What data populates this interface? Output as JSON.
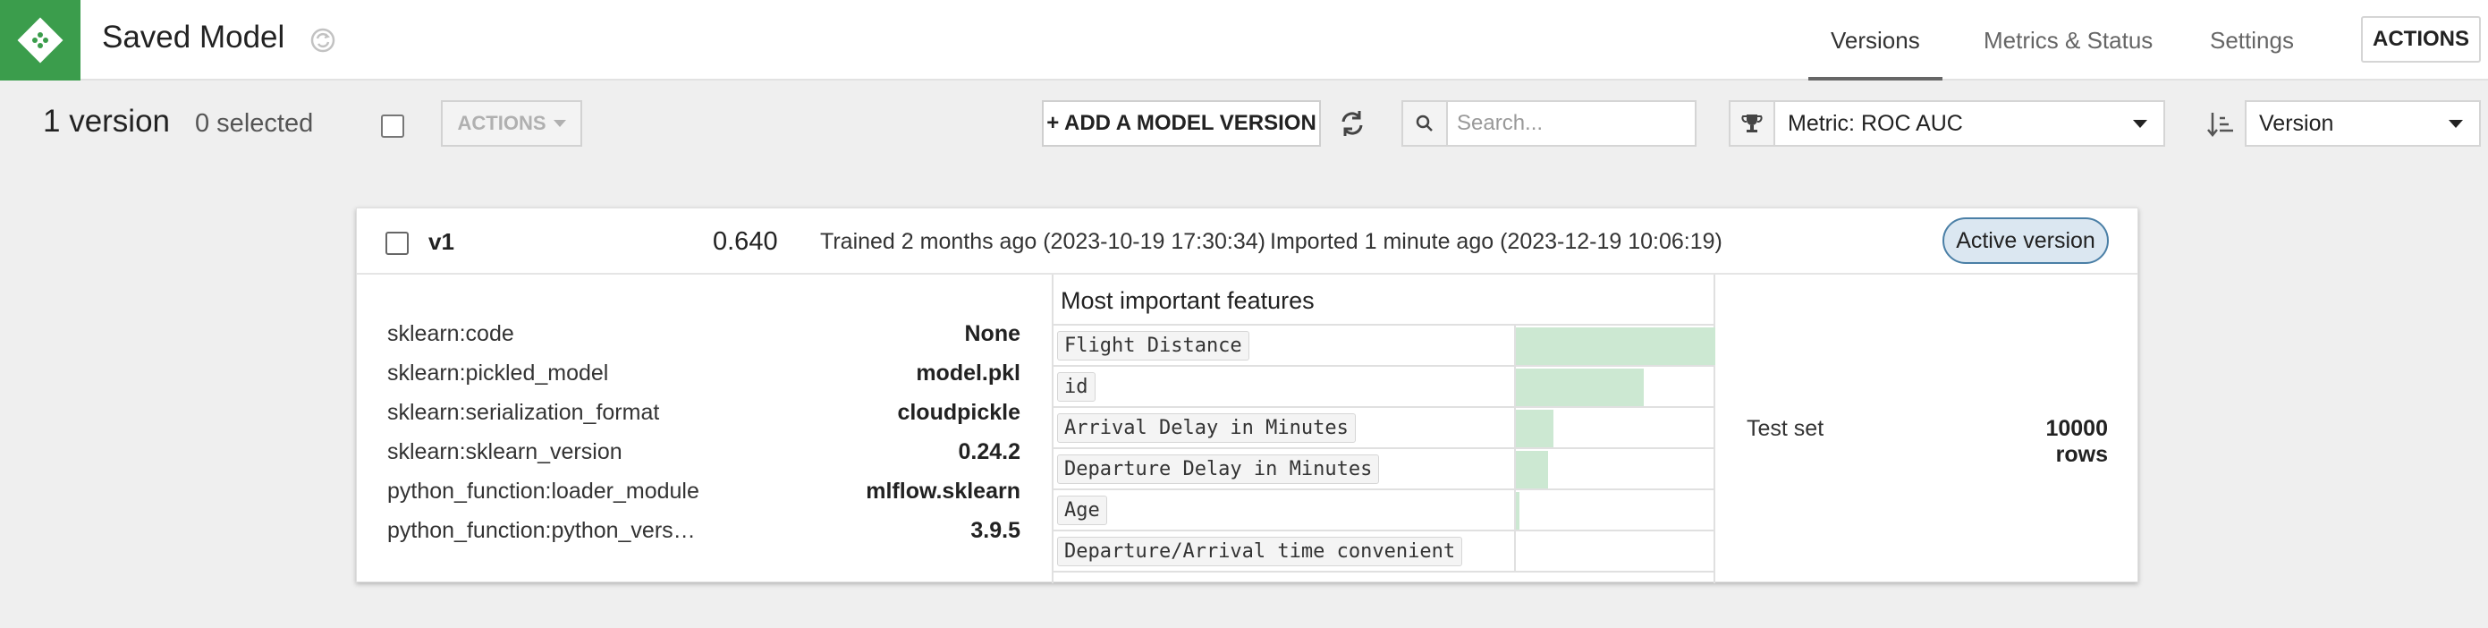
{
  "header": {
    "title": "Saved Model",
    "tabs": [
      {
        "label": "Versions",
        "active": true
      },
      {
        "label": "Metrics & Status",
        "active": false
      },
      {
        "label": "Settings",
        "active": false
      }
    ],
    "actions_label": "ACTIONS"
  },
  "toolbar": {
    "version_count": "1 version",
    "selected_count": "0 selected",
    "actions_label": "ACTIONS",
    "add_version_label": "+ ADD A MODEL VERSION",
    "search_placeholder": "Search...",
    "metric_label": "Metric: ROC AUC",
    "sort_label": "Version"
  },
  "version_card": {
    "name": "v1",
    "metric_value": "0.640",
    "trained": "Trained 2 months ago (2023-10-19 17:30:34)",
    "imported": "Imported 1 minute ago (2023-12-19 10:06:19)",
    "status": "Active version",
    "params": [
      {
        "key": "sklearn:code",
        "value": "None"
      },
      {
        "key": "sklearn:pickled_model",
        "value": "model.pkl"
      },
      {
        "key": "sklearn:serialization_format",
        "value": "cloudpickle"
      },
      {
        "key": "sklearn:sklearn_version",
        "value": "0.24.2"
      },
      {
        "key": "python_function:loader_module",
        "value": "mlflow.sklearn"
      },
      {
        "key": "python_function:python_vers…",
        "value": "3.9.5"
      }
    ],
    "features_title": "Most important features",
    "features": [
      {
        "name": "Flight Distance",
        "importance": 1.0
      },
      {
        "name": "id",
        "importance": 0.64
      },
      {
        "name": "Arrival Delay in Minutes",
        "importance": 0.19
      },
      {
        "name": "Departure Delay in Minutes",
        "importance": 0.16
      },
      {
        "name": "Age",
        "importance": 0.02
      },
      {
        "name": "Departure/Arrival time convenient",
        "importance": 0.0
      }
    ],
    "test_set_label": "Test set",
    "test_set_value": "10000 rows"
  },
  "colors": {
    "brand_green": "#3b9d4c",
    "feature_bar": "#cce8d2",
    "active_badge_bg": "#dbe7f1",
    "active_badge_border": "#4a7fa6"
  },
  "icons": [
    "logo-icon",
    "sync-icon",
    "refresh-icon",
    "search-icon",
    "trophy-icon",
    "sort-icon",
    "caret-down-icon"
  ]
}
